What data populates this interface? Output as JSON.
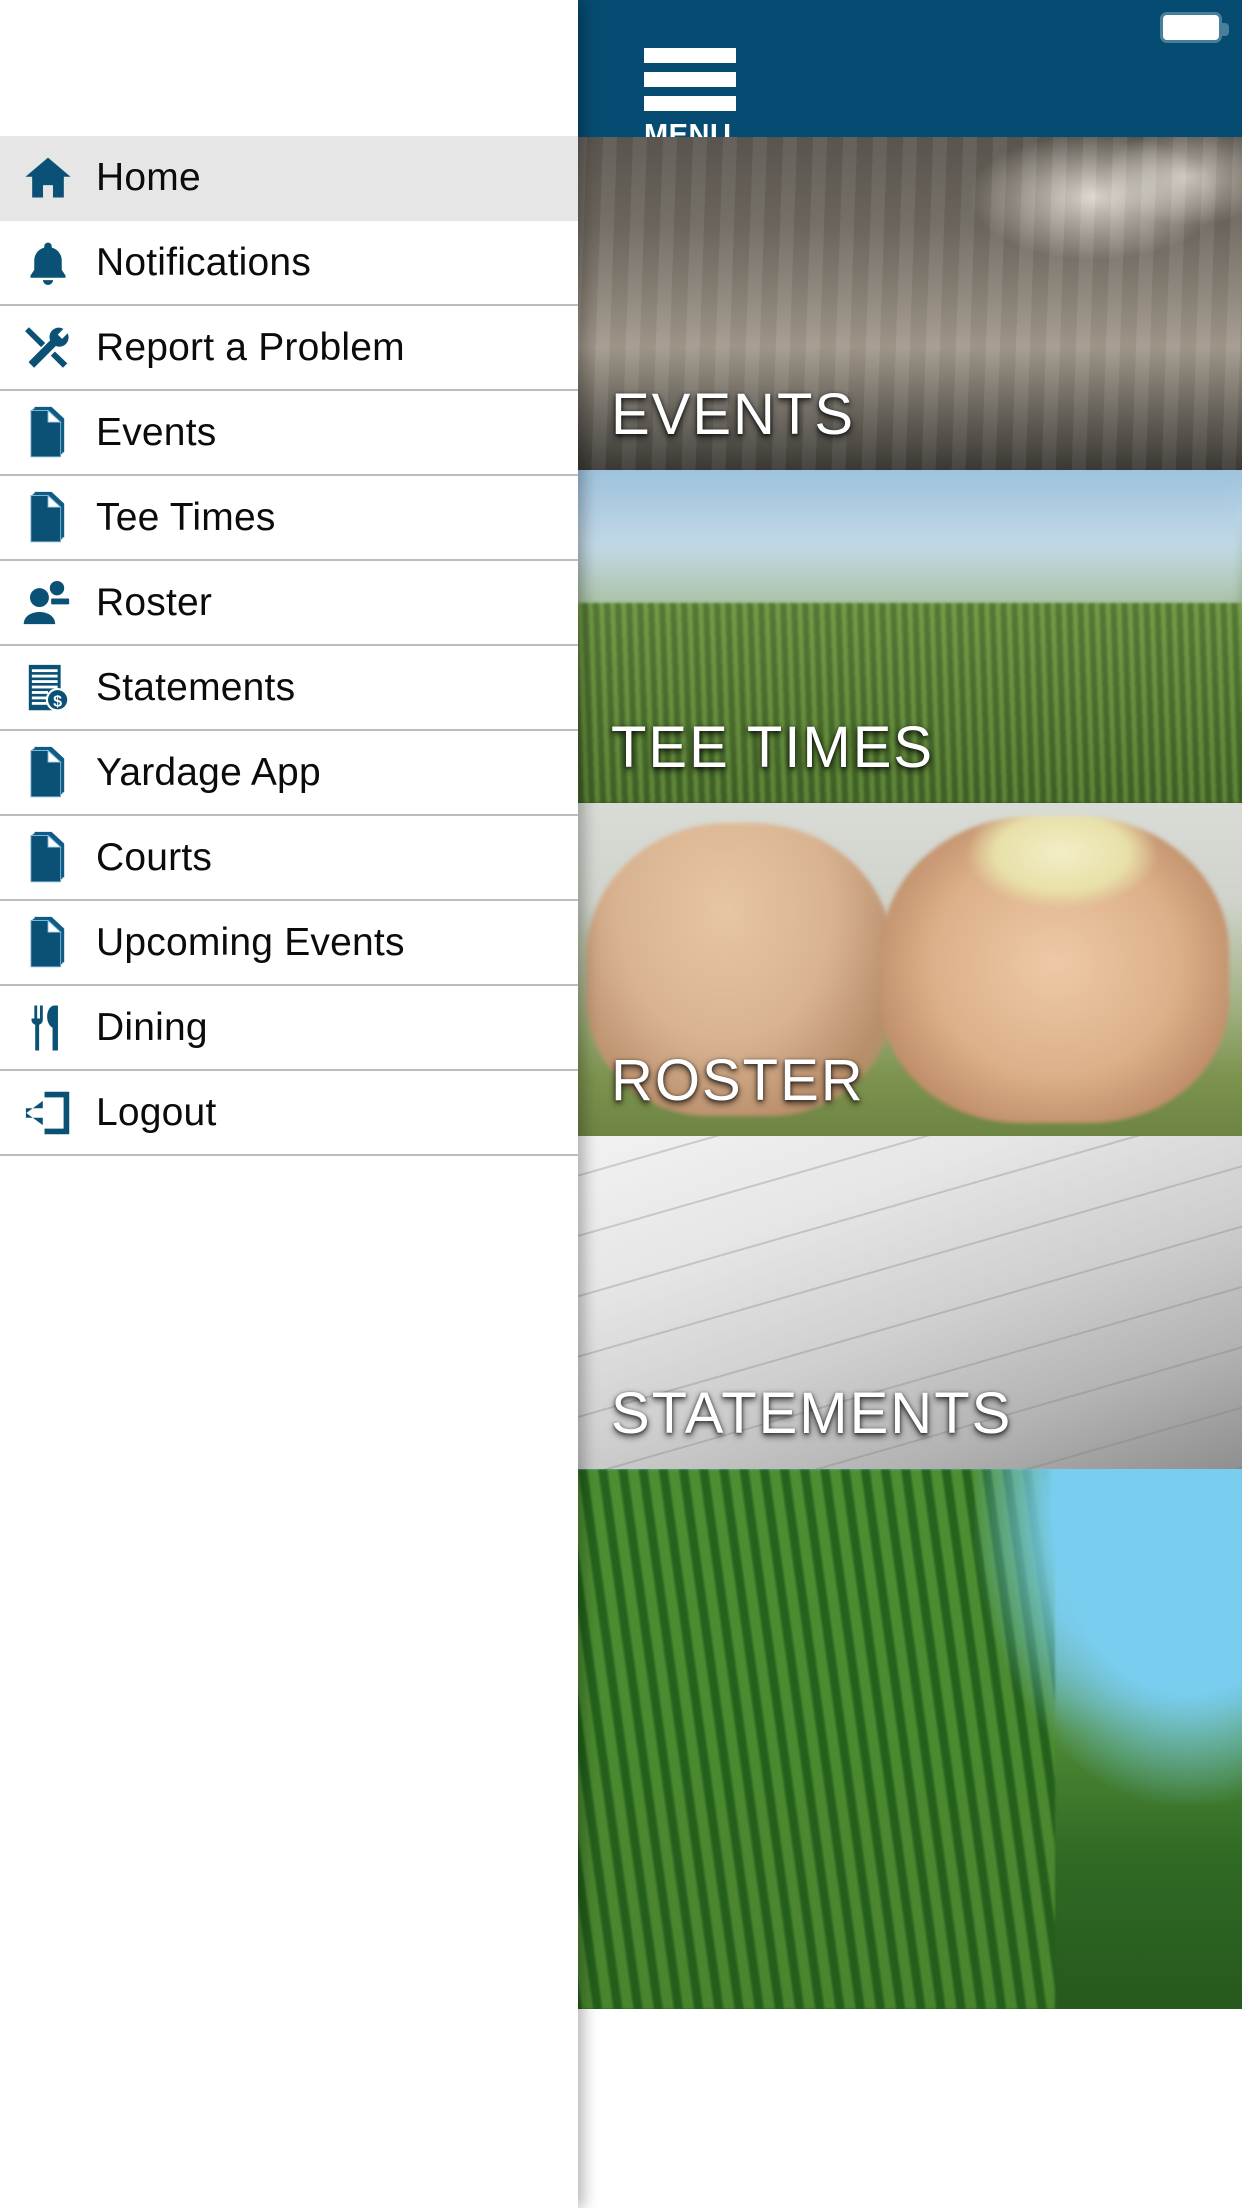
{
  "status_bar": {
    "battery_icon": "battery-icon"
  },
  "header": {
    "menu_label": "MENU",
    "menu_icon": "hamburger-icon",
    "background_color": "#064c72"
  },
  "drawer": {
    "accent_color": "#0a5175",
    "active_item_background": "#e6e6e6",
    "divider_color": "#bdbdbd",
    "items": [
      {
        "label": "Home",
        "icon": "home-icon",
        "active": true
      },
      {
        "label": "Notifications",
        "icon": "bell-icon",
        "active": false
      },
      {
        "label": "Report a Problem",
        "icon": "tools-icon",
        "active": false
      },
      {
        "label": "Events",
        "icon": "document-icon",
        "active": false
      },
      {
        "label": "Tee Times",
        "icon": "document-icon",
        "active": false
      },
      {
        "label": "Roster",
        "icon": "people-icon",
        "active": false
      },
      {
        "label": "Statements",
        "icon": "invoice-icon",
        "active": false
      },
      {
        "label": "Yardage App",
        "icon": "document-icon",
        "active": false
      },
      {
        "label": "Courts",
        "icon": "document-icon",
        "active": false
      },
      {
        "label": "Upcoming Events",
        "icon": "document-icon",
        "active": false
      },
      {
        "label": "Dining",
        "icon": "cutlery-icon",
        "active": false
      },
      {
        "label": "Logout",
        "icon": "logout-icon",
        "active": false
      }
    ]
  },
  "main": {
    "tiles": [
      {
        "label": "EVENTS",
        "art": "img-events"
      },
      {
        "label": "TEE TIMES",
        "art": "img-tee"
      },
      {
        "label": "ROSTER",
        "art": "img-roster"
      },
      {
        "label": "STATEMENTS",
        "art": "img-statements"
      },
      {
        "label": "",
        "art": "img-trees"
      }
    ]
  }
}
